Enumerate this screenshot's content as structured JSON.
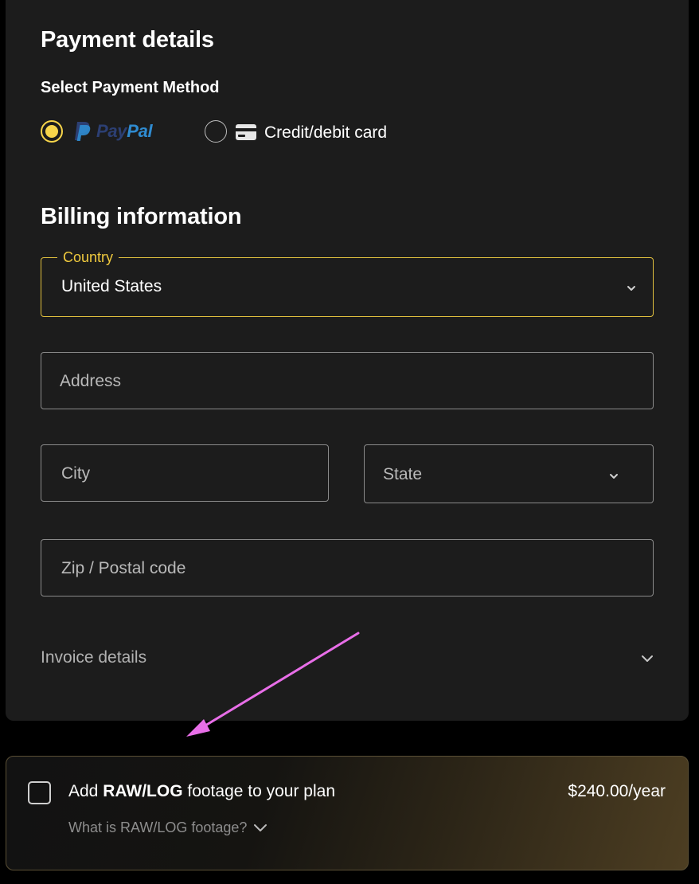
{
  "payment": {
    "title": "Payment details",
    "select_method_label": "Select Payment Method",
    "methods": [
      {
        "id": "paypal",
        "label_pay": "Pay",
        "label_pal": "Pal",
        "selected": true,
        "icon": "paypal-icon"
      },
      {
        "id": "card",
        "label": "Credit/debit card",
        "selected": false,
        "icon": "credit-card-icon"
      }
    ]
  },
  "billing": {
    "title": "Billing information",
    "country": {
      "label": "Country",
      "value": "United States"
    },
    "address": {
      "placeholder": "Address"
    },
    "city": {
      "placeholder": "City"
    },
    "state": {
      "placeholder": "State"
    },
    "zip": {
      "placeholder": "Zip / Postal code"
    },
    "invoice_details": "Invoice details"
  },
  "addon": {
    "title_prefix": "Add ",
    "title_bold": "RAW/LOG",
    "title_suffix": " footage to your plan",
    "price": "$240.00/year",
    "info_link": "What is RAW/LOG footage?"
  },
  "colors": {
    "accent": "#f7d54a",
    "card_bg": "#1c1c1c",
    "page_bg": "#000000",
    "annotation_arrow": "#e86ee8"
  }
}
